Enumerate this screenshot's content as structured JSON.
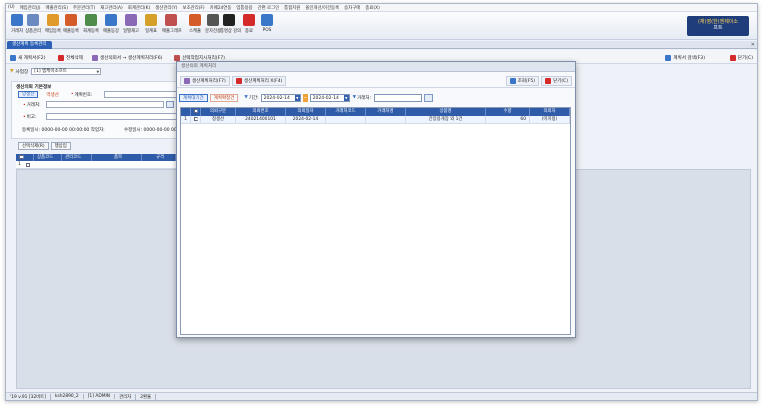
{
  "menu": [
    "(U)",
    "매입관리(J)",
    "매출관리(S)",
    "주문관리(T)",
    "재고관리(A)",
    "회계관리(K)",
    "생산관리(Y)",
    "보조관리(F)",
    "카페24연동",
    "업통용용",
    "간편 로그인",
    "통합지원",
    "올인개선/이건등록",
    "승차구매",
    "종료(X)"
  ],
  "toolbar": [
    {
      "label": "거래처",
      "color": "#3a77c9"
    },
    {
      "label": "상품관리",
      "color": "#6b8ac0"
    },
    {
      "label": "매입등록",
      "color": "#e09a2c"
    },
    {
      "label": "매출등록",
      "color": "#d45c2a"
    },
    {
      "label": "회계등록",
      "color": "#4e8c4a"
    },
    {
      "label": "매출등장",
      "color": "#3a77c9"
    },
    {
      "label": "일별재고",
      "color": "#8a6ab7"
    },
    {
      "label": "일계표",
      "color": "#d4a02a"
    },
    {
      "label": "매출그래프",
      "color": "#c05050"
    },
    {
      "label": "스케쥴",
      "color": "#d45c2a"
    },
    {
      "label": "문자전송",
      "color": "#555555"
    },
    {
      "label": "통명상 강의",
      "color": "#222222"
    },
    {
      "label": "종료",
      "color": "#d42a2a"
    },
    {
      "label": "POS",
      "color": "#3a77c9"
    }
  ],
  "brand": {
    "line1": "(재)영(한)엔제이소",
    "line2": "프트"
  },
  "tab": {
    "label": "생산계획 등록관리"
  },
  "pagebar": {
    "new_plan": "새 계획서(F2)",
    "delete": "전체삭제",
    "convert": "생산의뢰서 → 생산계획처리(F6)",
    "product_info": "선택작업지시처리(F7)",
    "plan_list": "계획서 검색(F3)",
    "close": "닫기(C)"
  },
  "business": {
    "label": "사업장",
    "value": "[1] 엠케이소프트"
  },
  "panel": {
    "title": "생산의뢰 기본정보",
    "radio_on": "양생산",
    "radio_off": "역생산",
    "plan_no_label": "계획번호:",
    "client_label": "거래처:",
    "memo_label": "비고:",
    "reg_info": "등록일시: 0000-00-00 00:00:00 작업자:",
    "mod_info": "수정일시: 0000-00-00 00:00"
  },
  "ghost_buttons": [
    "선택삭제(R)",
    "행삽입"
  ],
  "main_grid": {
    "headers": [
      "",
      "상품코드",
      "관리코드",
      "품목",
      "규격"
    ],
    "row_no": "1"
  },
  "status": [
    "'19 v.91 [32비트]",
    "ksh2890_2",
    "[1] ADMIN",
    "관리자",
    "2환율"
  ],
  "modal": {
    "title": "생산의뢰 계획처리",
    "btn_plan": "생산계획처리(F7)",
    "btn_cancel": "생산계획처리 X(F4)",
    "btn_search": "조회(F5)",
    "btn_close": "닫기(C)",
    "pill_on": "계획대기건",
    "pill_off": "계획확정건",
    "period_label": "기간:",
    "date_from": "2024-02-14",
    "date_to": "2024-02-14",
    "client_label": "거래처:",
    "grid_headers": [
      "",
      "",
      "의뢰구분",
      "의뢰번호",
      "의뢰일자",
      "거래처코드",
      "거래처명",
      "상품명",
      "수량",
      "의뢰자"
    ],
    "rows": [
      {
        "no": "1",
        "type": "정생산",
        "req_no": "24021400101",
        "date": "2024-02-14",
        "client_code": "",
        "client_name": "",
        "product": "간장용게장 외 1건",
        "qty": "60",
        "requester": "(미지정)"
      }
    ]
  }
}
